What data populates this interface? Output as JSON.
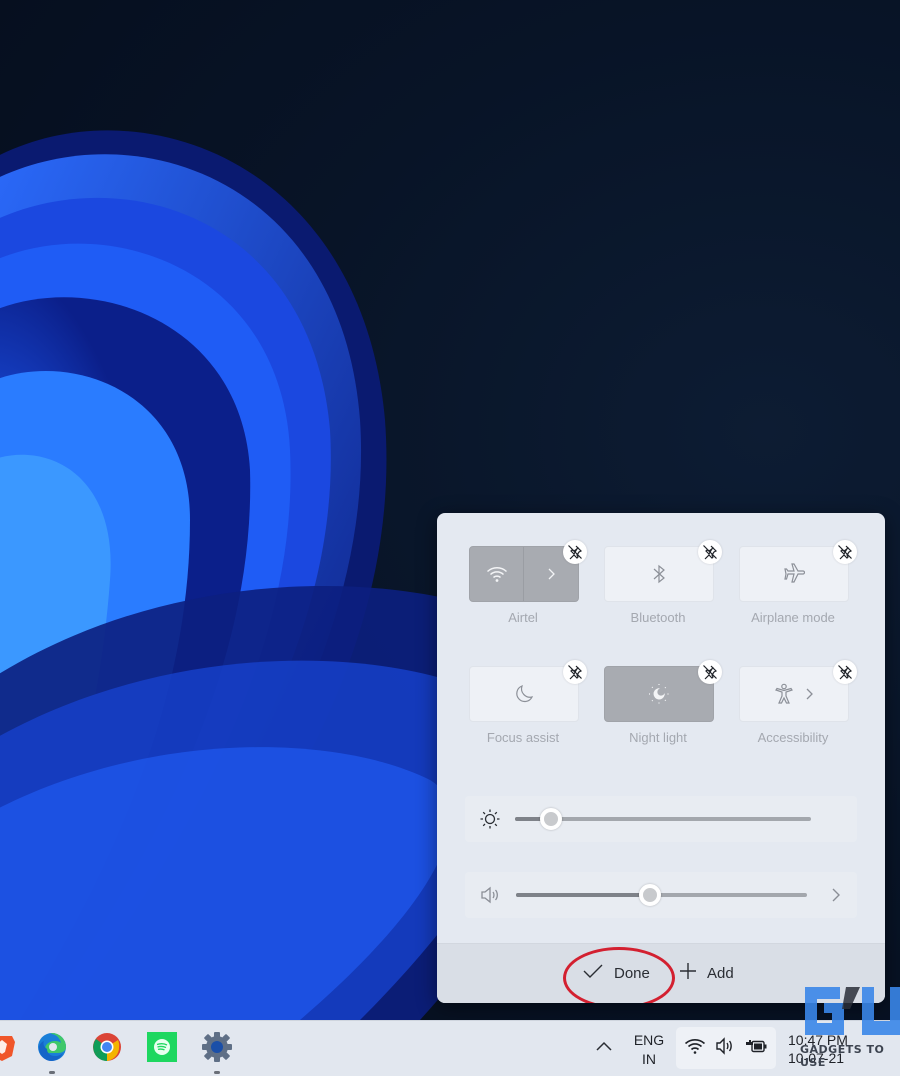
{
  "quick_settings": {
    "tiles": [
      {
        "id": "wifi",
        "label": "Airtel",
        "icon": "wifi-icon",
        "active": true,
        "has_expand": true
      },
      {
        "id": "bluetooth",
        "label": "Bluetooth",
        "icon": "bluetooth-icon",
        "active": false,
        "has_expand": false
      },
      {
        "id": "airplane",
        "label": "Airplane mode",
        "icon": "airplane-icon",
        "active": false,
        "has_expand": false
      },
      {
        "id": "focus",
        "label": "Focus assist",
        "icon": "moon-icon",
        "active": false,
        "has_expand": false
      },
      {
        "id": "nightlight",
        "label": "Night light",
        "icon": "night-light-icon",
        "active": true,
        "has_expand": false
      },
      {
        "id": "accessibility",
        "label": "Accessibility",
        "icon": "accessibility-icon",
        "active": false,
        "has_expand": true
      }
    ],
    "unpin_icon": "unpin-icon",
    "brightness": {
      "icon": "brightness-icon",
      "value_percent": 12
    },
    "volume": {
      "icon": "speaker-icon",
      "value_percent": 46,
      "has_expand": true
    },
    "footer": {
      "done_label": "Done",
      "add_label": "Add",
      "done_icon": "checkmark-icon",
      "add_icon": "plus-icon"
    },
    "annotation_color": "#d32030"
  },
  "taskbar": {
    "apps": [
      {
        "name": "brave",
        "icon": "brave-icon",
        "running": false
      },
      {
        "name": "edge",
        "icon": "edge-icon",
        "running": true
      },
      {
        "name": "chrome",
        "icon": "chrome-icon",
        "running": false
      },
      {
        "name": "spotify",
        "icon": "spotify-icon",
        "running": false
      },
      {
        "name": "settings",
        "icon": "settings-gear-icon",
        "running": true
      }
    ],
    "tray": {
      "overflow_icon": "chevron-up-icon",
      "language_line1": "ENG",
      "language_line2": "IN",
      "network_icon": "wifi-icon",
      "volume_icon": "speaker-icon",
      "battery_icon": "battery-charging-icon",
      "time": "10:47 PM",
      "date": "10-07-21"
    }
  },
  "watermark": {
    "text": "GADGETS TO USE"
  }
}
